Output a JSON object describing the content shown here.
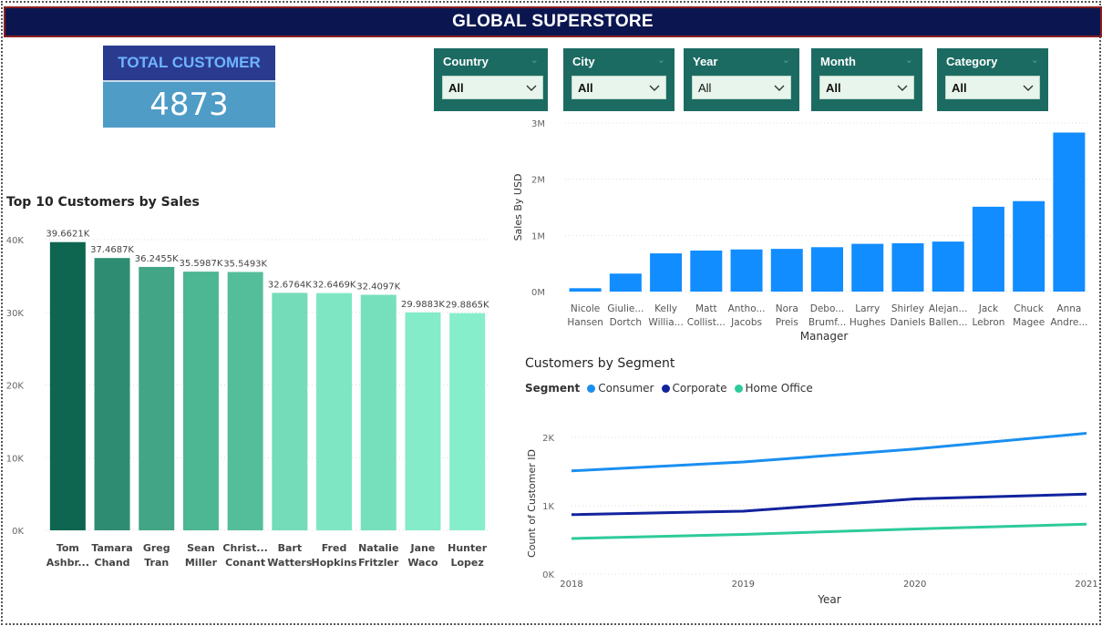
{
  "header": {
    "title": "GLOBAL SUPERSTORE"
  },
  "kpi": {
    "label": "TOTAL CUSTOMER",
    "value": "4873"
  },
  "slicers": [
    {
      "label": "Country",
      "value": "All"
    },
    {
      "label": "City",
      "value": "All"
    },
    {
      "label": "Year",
      "value": "All"
    },
    {
      "label": "Month",
      "value": "All"
    },
    {
      "label": "Category",
      "value": "All"
    }
  ],
  "colors": {
    "header_bg": "#0b1650",
    "slicer_bg": "#1c6b62",
    "manager_bar": "#118dff",
    "consumer": "#1a8ff0",
    "corporate": "#12239e",
    "home_office": "#2ecb9a"
  },
  "chart_data": [
    {
      "type": "bar",
      "title": "Top 10 Customers by Sales",
      "categories": [
        [
          "Tom",
          "Ashbr..."
        ],
        [
          "Tamara",
          "Chand"
        ],
        [
          "Greg",
          "Tran"
        ],
        [
          "Sean",
          "Miller"
        ],
        [
          "Christ...",
          "Conant"
        ],
        [
          "Bart",
          "Watters"
        ],
        [
          "Fred",
          "Hopkins"
        ],
        [
          "Natalie",
          "Fritzler"
        ],
        [
          "Jane",
          "Waco"
        ],
        [
          "Hunter",
          "Lopez"
        ]
      ],
      "values": [
        39662.1,
        37468.7,
        36245.5,
        35598.7,
        35549.3,
        32676.4,
        32646.9,
        32409.7,
        29988.3,
        29886.5
      ],
      "data_labels": [
        "39.6621K",
        "37.4687K",
        "36.2455K",
        "35.5987K",
        "35.5493K",
        "32.6764K",
        "32.6469K",
        "32.4097K",
        "29.9883K",
        "29.8865K"
      ],
      "bar_colors": [
        "#0e6550",
        "#2e8c72",
        "#42a585",
        "#4db692",
        "#54be9a",
        "#74dcb9",
        "#7ee6c3",
        "#76dfbc",
        "#84ecc9",
        "#86eecb"
      ],
      "yticks": [
        "0K",
        "10K",
        "20K",
        "30K",
        "40K"
      ],
      "ylim": [
        0,
        40000
      ]
    },
    {
      "type": "bar",
      "xlabel": "Manager",
      "ylabel": "Sales By USD",
      "categories": [
        [
          "Nicole",
          "Hansen"
        ],
        [
          "Giulie...",
          "Dortch"
        ],
        [
          "Kelly",
          "Willia..."
        ],
        [
          "Matt",
          "Collist..."
        ],
        [
          "Antho...",
          "Jacobs"
        ],
        [
          "Nora",
          "Preis"
        ],
        [
          "Debo...",
          "Brumf..."
        ],
        [
          "Larry",
          "Hughes"
        ],
        [
          "Shirley",
          "Daniels"
        ],
        [
          "Alejan...",
          "Ballen..."
        ],
        [
          "Jack",
          "Lebron"
        ],
        [
          "Chuck",
          "Magee"
        ],
        [
          "Anna",
          "Andre..."
        ]
      ],
      "values": [
        60000,
        320000,
        680000,
        730000,
        750000,
        760000,
        790000,
        850000,
        860000,
        890000,
        1510000,
        1610000,
        2830000
      ],
      "yticks": [
        "0M",
        "1M",
        "2M",
        "3M"
      ],
      "ylim": [
        0,
        3000000
      ]
    },
    {
      "type": "line",
      "title": "Customers by Segment",
      "legend_title": "Segment",
      "xlabel": "Year",
      "ylabel": "Count of Customer ID",
      "x": [
        "2018",
        "2019",
        "2020",
        "2021"
      ],
      "yticks": [
        "0K",
        "1K",
        "2K"
      ],
      "ylim": [
        0,
        2200
      ],
      "series": [
        {
          "name": "Consumer",
          "values": [
            1510,
            1640,
            1830,
            2060
          ]
        },
        {
          "name": "Corporate",
          "values": [
            870,
            920,
            1100,
            1170
          ]
        },
        {
          "name": "Home Office",
          "values": [
            520,
            580,
            660,
            730
          ]
        }
      ]
    }
  ]
}
